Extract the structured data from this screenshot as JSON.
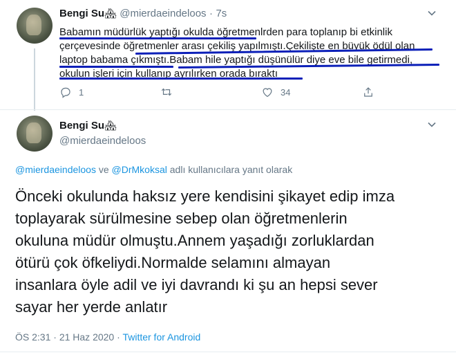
{
  "tweet1": {
    "name": "Bengi Su",
    "emoji": "🏘",
    "handle": "@mierdaeindeloos",
    "separator": "·",
    "time": "7s",
    "lines": [
      "Babamın müdürlük yaptığı okulda öğretmenlrden para toplanıp bi etkinlik",
      "çerçevesinde öğretmenler arası çekiliş yapılmıştı.Çekilişte en büyük ödül olan",
      "laptop babama çıkmıştı.Babam hile yaptığı düşünülür diye eve bile getirmedi,",
      "okulun işleri için kullanıp ayrılırken orada bıraktı"
    ],
    "reply_count": "1",
    "retweet_count": "",
    "like_count": "34"
  },
  "tweet2": {
    "name": "Bengi Su",
    "emoji": "🏘",
    "handle": "@mierdaeindeloos",
    "reply_to": {
      "user1": "@mierdaeindeloos",
      "conj": " ve ",
      "user2": "@DrMkoksal",
      "suffix": " adlı kullanıcılara yanıt olarak"
    },
    "lines": [
      "Önceki okulunda haksız yere kendisini şikayet edip imza",
      "toplayarak sürülmesine sebep olan öğretmenlerin",
      "okuluna müdür olmuştu.Annem yaşadığı zorluklardan",
      "ötürü çok öfkeliydi.Normalde selamını almayan",
      "insanlara öyle adil ve iyi davrandı ki şu an hepsi sever",
      "sayar her yerde anlatır"
    ],
    "time": "ÖS 2:31",
    "date_sep": " · ",
    "date": "21 Haz 2020",
    "source": "Twitter for Android"
  },
  "colors": {
    "link": "#1b95e0",
    "secondary_text": "#657786",
    "underline_marker": "#0b1fb8"
  },
  "icons": {
    "reply": "reply-icon",
    "retweet": "retweet-icon",
    "like": "heart-icon",
    "share": "share-icon",
    "menu": "chevron-down-icon"
  }
}
